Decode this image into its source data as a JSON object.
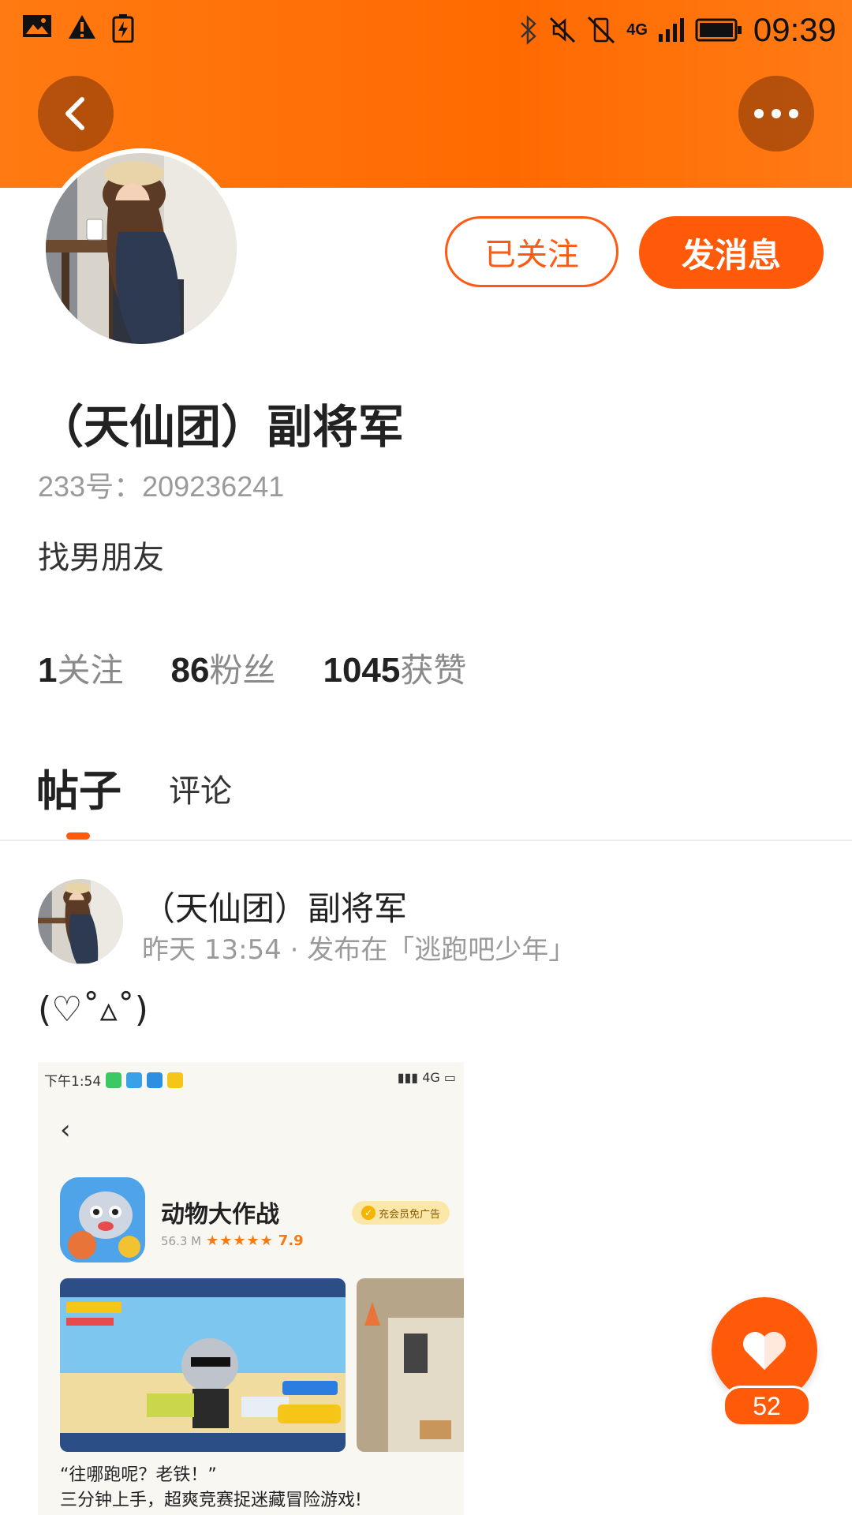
{
  "status_bar": {
    "time": "09:39",
    "network": "4G",
    "left_icons": [
      "image-icon",
      "warning-icon",
      "battery-saver-icon"
    ],
    "right_icons": [
      "bluetooth-icon",
      "mute-icon",
      "no-vibrate-icon",
      "signal-icon",
      "battery-icon"
    ]
  },
  "header": {
    "back_icon": "chevron-left-icon",
    "more_icon": "more-dots-icon",
    "accent_color": "#ff6a00"
  },
  "profile": {
    "name": "（天仙团）副将军",
    "id_text": "233号：209236241",
    "bio": "找男朋友",
    "follow_button": "已关注",
    "message_button": "发消息",
    "stats": [
      {
        "num": "1",
        "label": "关注"
      },
      {
        "num": "86",
        "label": "粉丝"
      },
      {
        "num": "1045",
        "label": "获赞"
      }
    ]
  },
  "tabs": [
    {
      "label": "帖子",
      "active": true
    },
    {
      "label": "评论",
      "active": false
    }
  ],
  "post": {
    "author": "（天仙团）副将军",
    "meta": "昨天 13:54 · 发布在「逃跑吧少年」",
    "text": "(♡˚▵˚)",
    "image": {
      "status_time": "下午1:54",
      "status_network": "4G",
      "app_title": "动物大作战",
      "app_size": "56.3 M",
      "stars": "★★★★★",
      "rating": "7.9",
      "vip_badge": "充会员免广告",
      "quote_line1": "“往哪跑呢？老铁！”",
      "quote_line2": "三分钟上手，超爽竞赛捉迷藏冒险游戏!"
    }
  },
  "like": {
    "count": "52",
    "icon": "heart-icon"
  }
}
